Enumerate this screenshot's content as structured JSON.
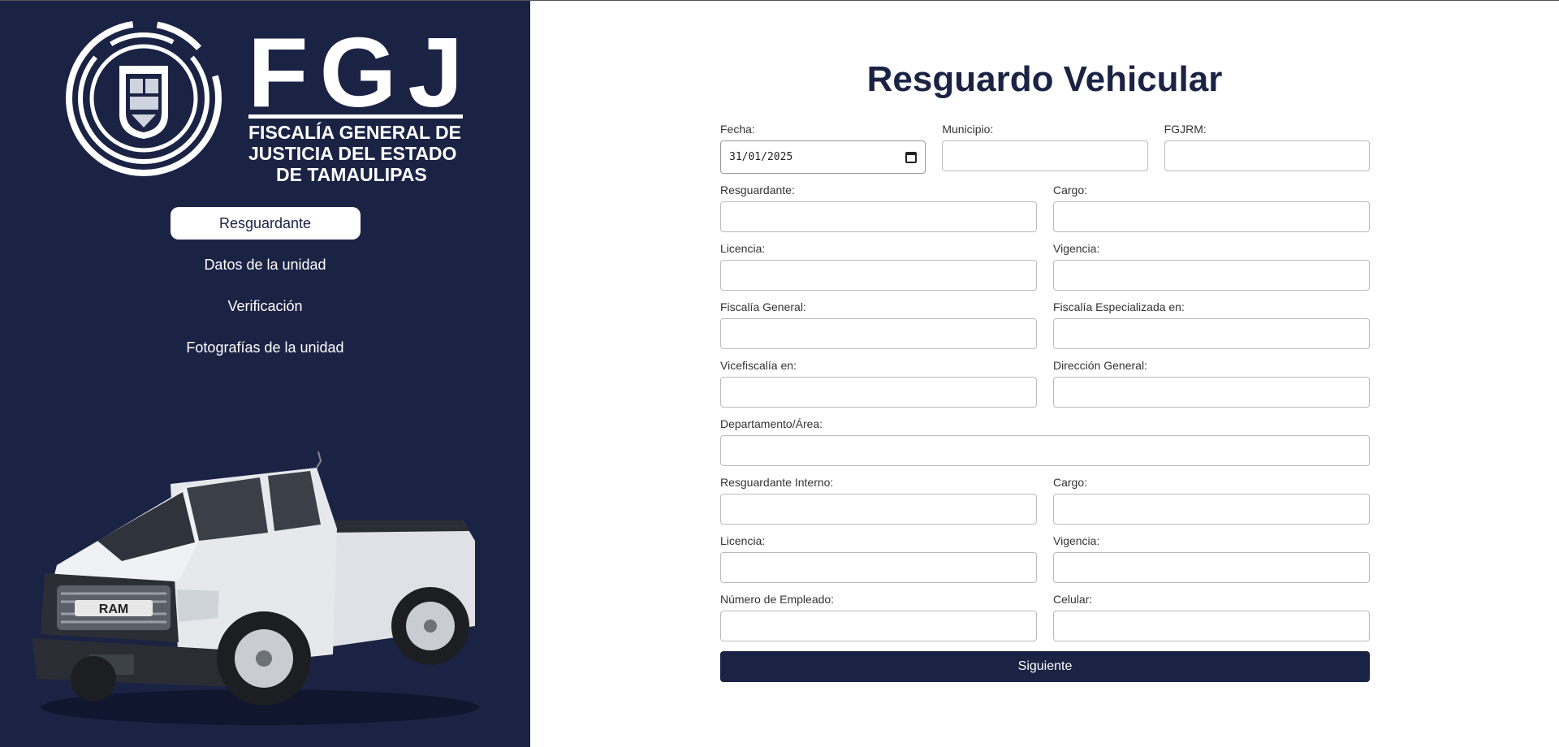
{
  "logo": {
    "letters": "FGJ",
    "lines": [
      "FISCALÍA GENERAL DE",
      "JUSTICIA DEL ESTADO",
      "DE TAMAULIPAS"
    ]
  },
  "nav": {
    "items": [
      {
        "label": "Resguardante",
        "active": true
      },
      {
        "label": "Datos de la unidad",
        "active": false
      },
      {
        "label": "Verificación",
        "active": false
      },
      {
        "label": "Fotografías de la unidad",
        "active": false
      }
    ]
  },
  "truck": {
    "badge": "RAM"
  },
  "form": {
    "title": "Resguardo Vehicular",
    "fecha": {
      "label": "Fecha:",
      "value": "31/01/2025"
    },
    "municipio": {
      "label": "Municipio:",
      "value": ""
    },
    "fgjrm": {
      "label": "FGJRM:",
      "value": ""
    },
    "resguardante": {
      "label": "Resguardante:",
      "value": ""
    },
    "cargo": {
      "label": "Cargo:",
      "value": ""
    },
    "licencia": {
      "label": "Licencia:",
      "value": ""
    },
    "vigencia": {
      "label": "Vigencia:",
      "value": ""
    },
    "fiscalia_general": {
      "label": "Fiscalía General:",
      "value": ""
    },
    "fiscalia_especializada": {
      "label": "Fiscalía Especializada en:",
      "value": ""
    },
    "vicefiscalia": {
      "label": "Vicefiscalía en:",
      "value": ""
    },
    "direccion_general": {
      "label": "Dirección General:",
      "value": ""
    },
    "departamento": {
      "label": "Departamento/Área:",
      "value": ""
    },
    "resguardante_interno": {
      "label": "Resguardante Interno:",
      "value": ""
    },
    "cargo_interno": {
      "label": "Cargo:",
      "value": ""
    },
    "licencia_interno": {
      "label": "Licencia:",
      "value": ""
    },
    "vigencia_interno": {
      "label": "Vigencia:",
      "value": ""
    },
    "numero_empleado": {
      "label": "Número de Empleado:",
      "value": ""
    },
    "celular": {
      "label": "Celular:",
      "value": ""
    },
    "submit_label": "Siguiente"
  },
  "colors": {
    "sidebar": "#1b2345",
    "accent": "#1b2345",
    "background": "#ffffff"
  }
}
